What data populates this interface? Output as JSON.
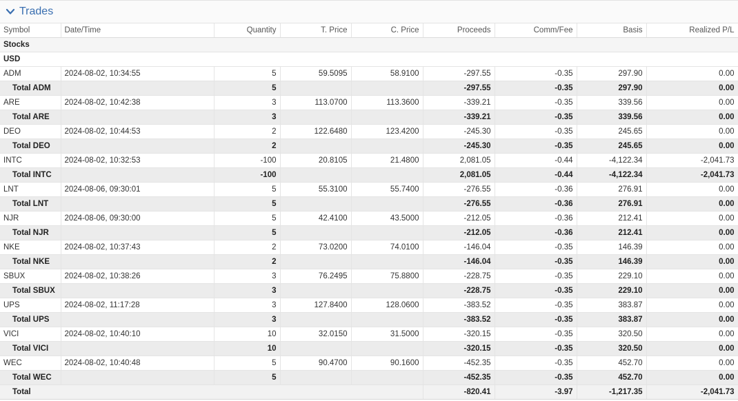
{
  "section": {
    "title": "Trades",
    "icon": "chevron-down-icon"
  },
  "columns": [
    "Symbol",
    "Date/Time",
    "Quantity",
    "T. Price",
    "C. Price",
    "Proceeds",
    "Comm/Fee",
    "Basis",
    "Realized P/L"
  ],
  "asset_class": "Stocks",
  "currency": "USD",
  "rows": [
    {
      "type": "trade",
      "symbol": "ADM",
      "datetime": "2024-08-02, 10:34:55",
      "quantity": "5",
      "t_price": "59.5095",
      "c_price": "58.9100",
      "proceeds": "-297.55",
      "comm_fee": "-0.35",
      "basis": "297.90",
      "realized_pl": "0.00"
    },
    {
      "type": "subtotal",
      "symbol": "Total ADM",
      "datetime": "",
      "quantity": "5",
      "t_price": "",
      "c_price": "",
      "proceeds": "-297.55",
      "comm_fee": "-0.35",
      "basis": "297.90",
      "realized_pl": "0.00"
    },
    {
      "type": "trade",
      "symbol": "ARE",
      "datetime": "2024-08-02, 10:42:38",
      "quantity": "3",
      "t_price": "113.0700",
      "c_price": "113.3600",
      "proceeds": "-339.21",
      "comm_fee": "-0.35",
      "basis": "339.56",
      "realized_pl": "0.00"
    },
    {
      "type": "subtotal",
      "symbol": "Total ARE",
      "datetime": "",
      "quantity": "3",
      "t_price": "",
      "c_price": "",
      "proceeds": "-339.21",
      "comm_fee": "-0.35",
      "basis": "339.56",
      "realized_pl": "0.00"
    },
    {
      "type": "trade",
      "symbol": "DEO",
      "datetime": "2024-08-02, 10:44:53",
      "quantity": "2",
      "t_price": "122.6480",
      "c_price": "123.4200",
      "proceeds": "-245.30",
      "comm_fee": "-0.35",
      "basis": "245.65",
      "realized_pl": "0.00"
    },
    {
      "type": "subtotal",
      "symbol": "Total DEO",
      "datetime": "",
      "quantity": "2",
      "t_price": "",
      "c_price": "",
      "proceeds": "-245.30",
      "comm_fee": "-0.35",
      "basis": "245.65",
      "realized_pl": "0.00"
    },
    {
      "type": "trade",
      "symbol": "INTC",
      "datetime": "2024-08-02, 10:32:53",
      "quantity": "-100",
      "t_price": "20.8105",
      "c_price": "21.4800",
      "proceeds": "2,081.05",
      "comm_fee": "-0.44",
      "basis": "-4,122.34",
      "realized_pl": "-2,041.73"
    },
    {
      "type": "subtotal",
      "symbol": "Total INTC",
      "datetime": "",
      "quantity": "-100",
      "t_price": "",
      "c_price": "",
      "proceeds": "2,081.05",
      "comm_fee": "-0.44",
      "basis": "-4,122.34",
      "realized_pl": "-2,041.73"
    },
    {
      "type": "trade",
      "symbol": "LNT",
      "datetime": "2024-08-06, 09:30:01",
      "quantity": "5",
      "t_price": "55.3100",
      "c_price": "55.7400",
      "proceeds": "-276.55",
      "comm_fee": "-0.36",
      "basis": "276.91",
      "realized_pl": "0.00"
    },
    {
      "type": "subtotal",
      "symbol": "Total LNT",
      "datetime": "",
      "quantity": "5",
      "t_price": "",
      "c_price": "",
      "proceeds": "-276.55",
      "comm_fee": "-0.36",
      "basis": "276.91",
      "realized_pl": "0.00"
    },
    {
      "type": "trade",
      "symbol": "NJR",
      "datetime": "2024-08-06, 09:30:00",
      "quantity": "5",
      "t_price": "42.4100",
      "c_price": "43.5000",
      "proceeds": "-212.05",
      "comm_fee": "-0.36",
      "basis": "212.41",
      "realized_pl": "0.00"
    },
    {
      "type": "subtotal",
      "symbol": "Total NJR",
      "datetime": "",
      "quantity": "5",
      "t_price": "",
      "c_price": "",
      "proceeds": "-212.05",
      "comm_fee": "-0.36",
      "basis": "212.41",
      "realized_pl": "0.00"
    },
    {
      "type": "trade",
      "symbol": "NKE",
      "datetime": "2024-08-02, 10:37:43",
      "quantity": "2",
      "t_price": "73.0200",
      "c_price": "74.0100",
      "proceeds": "-146.04",
      "comm_fee": "-0.35",
      "basis": "146.39",
      "realized_pl": "0.00"
    },
    {
      "type": "subtotal",
      "symbol": "Total NKE",
      "datetime": "",
      "quantity": "2",
      "t_price": "",
      "c_price": "",
      "proceeds": "-146.04",
      "comm_fee": "-0.35",
      "basis": "146.39",
      "realized_pl": "0.00"
    },
    {
      "type": "trade",
      "symbol": "SBUX",
      "datetime": "2024-08-02, 10:38:26",
      "quantity": "3",
      "t_price": "76.2495",
      "c_price": "75.8800",
      "proceeds": "-228.75",
      "comm_fee": "-0.35",
      "basis": "229.10",
      "realized_pl": "0.00"
    },
    {
      "type": "subtotal",
      "symbol": "Total SBUX",
      "datetime": "",
      "quantity": "3",
      "t_price": "",
      "c_price": "",
      "proceeds": "-228.75",
      "comm_fee": "-0.35",
      "basis": "229.10",
      "realized_pl": "0.00"
    },
    {
      "type": "trade",
      "symbol": "UPS",
      "datetime": "2024-08-02, 11:17:28",
      "quantity": "3",
      "t_price": "127.8400",
      "c_price": "128.0600",
      "proceeds": "-383.52",
      "comm_fee": "-0.35",
      "basis": "383.87",
      "realized_pl": "0.00"
    },
    {
      "type": "subtotal",
      "symbol": "Total UPS",
      "datetime": "",
      "quantity": "3",
      "t_price": "",
      "c_price": "",
      "proceeds": "-383.52",
      "comm_fee": "-0.35",
      "basis": "383.87",
      "realized_pl": "0.00"
    },
    {
      "type": "trade",
      "symbol": "VICI",
      "datetime": "2024-08-02, 10:40:10",
      "quantity": "10",
      "t_price": "32.0150",
      "c_price": "31.5000",
      "proceeds": "-320.15",
      "comm_fee": "-0.35",
      "basis": "320.50",
      "realized_pl": "0.00"
    },
    {
      "type": "subtotal",
      "symbol": "Total VICI",
      "datetime": "",
      "quantity": "10",
      "t_price": "",
      "c_price": "",
      "proceeds": "-320.15",
      "comm_fee": "-0.35",
      "basis": "320.50",
      "realized_pl": "0.00"
    },
    {
      "type": "trade",
      "symbol": "WEC",
      "datetime": "2024-08-02, 10:40:48",
      "quantity": "5",
      "t_price": "90.4700",
      "c_price": "90.1600",
      "proceeds": "-452.35",
      "comm_fee": "-0.35",
      "basis": "452.70",
      "realized_pl": "0.00"
    },
    {
      "type": "subtotal",
      "symbol": "Total WEC",
      "datetime": "",
      "quantity": "5",
      "t_price": "",
      "c_price": "",
      "proceeds": "-452.35",
      "comm_fee": "-0.35",
      "basis": "452.70",
      "realized_pl": "0.00"
    }
  ],
  "grand_total": {
    "symbol": "Total",
    "proceeds": "-820.41",
    "comm_fee": "-3.97",
    "basis": "-1,217.35",
    "realized_pl": "-2,041.73"
  },
  "colors": {
    "accent": "#3a6fb0",
    "subtotal_bg": "#ececec",
    "border": "#e4e4e4"
  }
}
